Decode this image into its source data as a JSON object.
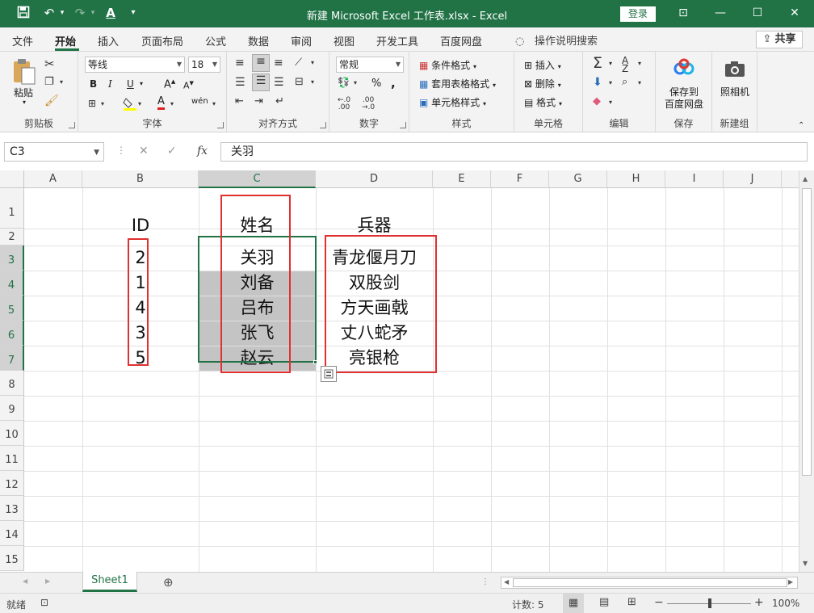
{
  "titlebar": {
    "save_icon": "save-icon",
    "undo_icon": "undo-icon",
    "redo_icon": "redo-icon",
    "font_color_icon": "A",
    "customize_icon": "▾",
    "title": "新建 Microsoft Excel 工作表.xlsx  -  Excel",
    "login": "登录",
    "ribbon_display": "⊡",
    "minimize": "—",
    "maximize": "☐",
    "close": "✕"
  },
  "tabs": {
    "items": [
      "文件",
      "开始",
      "插入",
      "页面布局",
      "公式",
      "数据",
      "审阅",
      "视图",
      "开发工具",
      "百度网盘"
    ],
    "active": "开始",
    "tell_me": "操作说明搜索",
    "share": "共享"
  },
  "ribbon": {
    "clipboard": {
      "name": "剪贴板",
      "paste": "粘贴"
    },
    "font": {
      "name": "字体",
      "family": "等线",
      "size": "18",
      "bold": "B",
      "italic": "I",
      "underline": "U",
      "grow": "A",
      "shrink": "A",
      "font_color": "A",
      "phonetic": "wén"
    },
    "alignment": {
      "name": "对齐方式"
    },
    "number": {
      "name": "数字",
      "format": "常规",
      "percent": "%",
      "comma": ","
    },
    "styles": {
      "name": "样式",
      "conditional": "条件格式",
      "table": "套用表格格式",
      "cell": "单元格样式"
    },
    "cells": {
      "name": "单元格",
      "insert": "插入",
      "delete": "删除",
      "format": "格式"
    },
    "editing": {
      "name": "编辑"
    },
    "save": {
      "name": "保存",
      "button_line1": "保存到",
      "button_line2": "百度网盘"
    },
    "newgroup": {
      "name": "新建组",
      "camera": "照相机"
    }
  },
  "formula_bar": {
    "name_box": "C3",
    "cancel": "✕",
    "enter": "✓",
    "fx": "fx",
    "value": "关羽"
  },
  "grid": {
    "columns": [
      "A",
      "B",
      "C",
      "D",
      "E",
      "F",
      "G",
      "H",
      "I",
      "J"
    ],
    "rows": [
      "1",
      "2",
      "3",
      "4",
      "5",
      "6",
      "7",
      "8",
      "9",
      "10",
      "11",
      "12",
      "13",
      "14",
      "15"
    ],
    "selected_column": "C",
    "selected_rows": [
      "3",
      "4",
      "5",
      "6",
      "7"
    ],
    "header_row": {
      "B": "ID",
      "C": "姓名",
      "D": "兵器"
    },
    "data": [
      {
        "id": "2",
        "name": "关羽",
        "weapon": "青龙偃月刀"
      },
      {
        "id": "1",
        "name": "刘备",
        "weapon": "双股剑"
      },
      {
        "id": "4",
        "name": "吕布",
        "weapon": "方天画戟"
      },
      {
        "id": "3",
        "name": "张飞",
        "weapon": "丈八蛇矛"
      },
      {
        "id": "5",
        "name": "赵云",
        "weapon": "亮银枪"
      }
    ]
  },
  "sheets": {
    "tabs": [
      "Sheet1"
    ],
    "add": "⊕"
  },
  "status": {
    "mode": "就绪",
    "count": "计数: 5",
    "zoom": "100%",
    "minus": "−",
    "plus": "+"
  },
  "colors": {
    "accent": "#217346",
    "highlight": "#e03030",
    "selection_fill": "#c4c4c4"
  }
}
